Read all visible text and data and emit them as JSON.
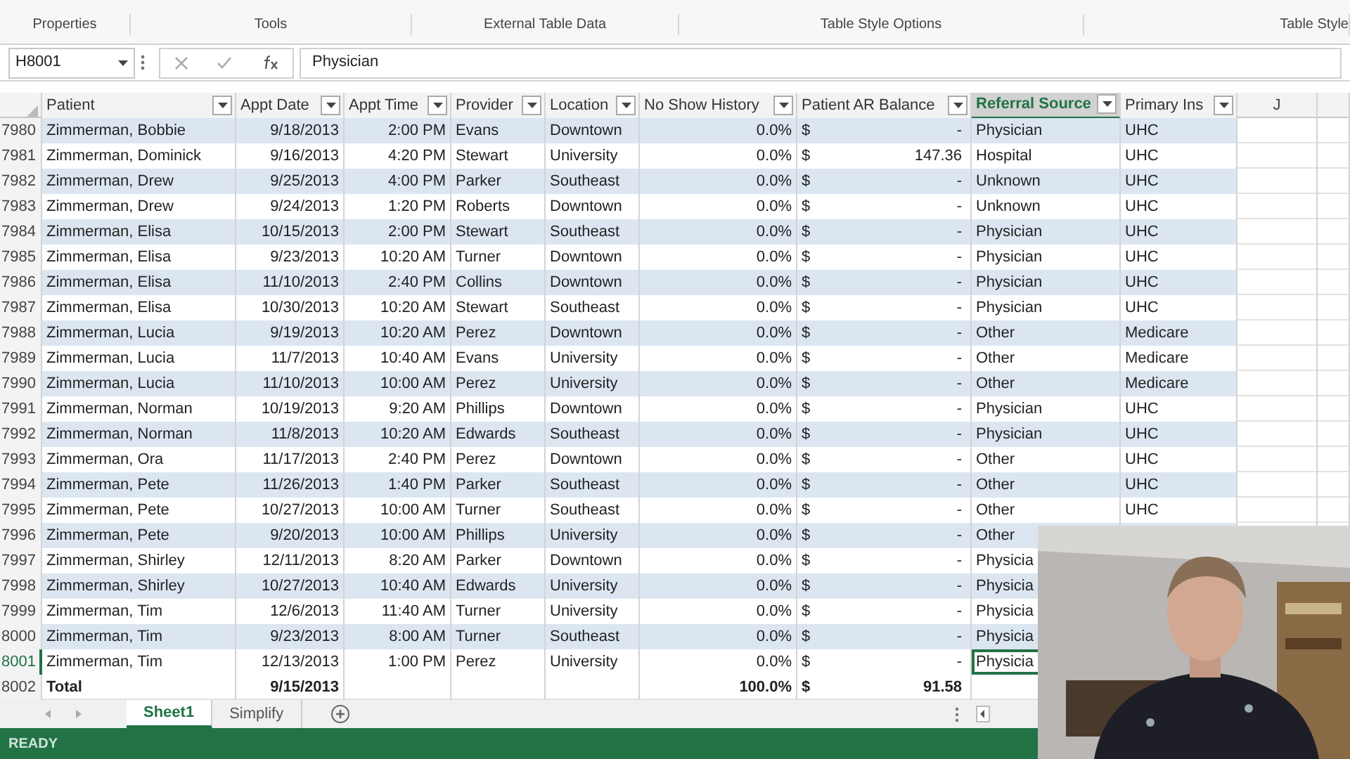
{
  "ribbon": {
    "groups": [
      "Properties",
      "Tools",
      "External Table Data",
      "Table Style Options",
      "Table Style"
    ]
  },
  "formula_bar": {
    "name_box": "H8001",
    "value": "Physician"
  },
  "columns": [
    {
      "kind": "filter",
      "label": "Patient",
      "selected": false
    },
    {
      "kind": "filter",
      "label": "Appt Date",
      "selected": false
    },
    {
      "kind": "filter",
      "label": "Appt Time",
      "selected": false
    },
    {
      "kind": "filter",
      "label": "Provider",
      "selected": false
    },
    {
      "kind": "filter",
      "label": "Location",
      "selected": false
    },
    {
      "kind": "filter",
      "label": "No Show History",
      "selected": false
    },
    {
      "kind": "filter",
      "label": "Patient AR Balance",
      "selected": false
    },
    {
      "kind": "filter",
      "label": "Referral Source",
      "selected": true
    },
    {
      "kind": "filter",
      "label": "Primary Ins",
      "selected": false
    },
    {
      "kind": "letter",
      "label": "J"
    }
  ],
  "rows": [
    {
      "n": "7980",
      "patient": "Zimmerman, Bobbie",
      "date": "9/18/2013",
      "time": "2:00 PM",
      "provider": "Evans",
      "location": "Downtown",
      "noshow": "0.0%",
      "cur": "$",
      "bal": "-",
      "ref": "Physician",
      "ins": "UHC",
      "selected": false
    },
    {
      "n": "7981",
      "patient": "Zimmerman, Dominick",
      "date": "9/16/2013",
      "time": "4:20 PM",
      "provider": "Stewart",
      "location": "University",
      "noshow": "0.0%",
      "cur": "$",
      "bal": "147.36",
      "ref": "Hospital",
      "ins": "UHC",
      "selected": false
    },
    {
      "n": "7982",
      "patient": "Zimmerman, Drew",
      "date": "9/25/2013",
      "time": "4:00 PM",
      "provider": "Parker",
      "location": "Southeast",
      "noshow": "0.0%",
      "cur": "$",
      "bal": "-",
      "ref": "Unknown",
      "ins": "UHC",
      "selected": false
    },
    {
      "n": "7983",
      "patient": "Zimmerman, Drew",
      "date": "9/24/2013",
      "time": "1:20 PM",
      "provider": "Roberts",
      "location": "Downtown",
      "noshow": "0.0%",
      "cur": "$",
      "bal": "-",
      "ref": "Unknown",
      "ins": "UHC",
      "selected": false
    },
    {
      "n": "7984",
      "patient": "Zimmerman, Elisa",
      "date": "10/15/2013",
      "time": "2:00 PM",
      "provider": "Stewart",
      "location": "Southeast",
      "noshow": "0.0%",
      "cur": "$",
      "bal": "-",
      "ref": "Physician",
      "ins": "UHC",
      "selected": false
    },
    {
      "n": "7985",
      "patient": "Zimmerman, Elisa",
      "date": "9/23/2013",
      "time": "10:20 AM",
      "provider": "Turner",
      "location": "Downtown",
      "noshow": "0.0%",
      "cur": "$",
      "bal": "-",
      "ref": "Physician",
      "ins": "UHC",
      "selected": false
    },
    {
      "n": "7986",
      "patient": "Zimmerman, Elisa",
      "date": "11/10/2013",
      "time": "2:40 PM",
      "provider": "Collins",
      "location": "Downtown",
      "noshow": "0.0%",
      "cur": "$",
      "bal": "-",
      "ref": "Physician",
      "ins": "UHC",
      "selected": false
    },
    {
      "n": "7987",
      "patient": "Zimmerman, Elisa",
      "date": "10/30/2013",
      "time": "10:20 AM",
      "provider": "Stewart",
      "location": "Southeast",
      "noshow": "0.0%",
      "cur": "$",
      "bal": "-",
      "ref": "Physician",
      "ins": "UHC",
      "selected": false
    },
    {
      "n": "7988",
      "patient": "Zimmerman, Lucia",
      "date": "9/19/2013",
      "time": "10:20 AM",
      "provider": "Perez",
      "location": "Downtown",
      "noshow": "0.0%",
      "cur": "$",
      "bal": "-",
      "ref": "Other",
      "ins": "Medicare",
      "selected": false
    },
    {
      "n": "7989",
      "patient": "Zimmerman, Lucia",
      "date": "11/7/2013",
      "time": "10:40 AM",
      "provider": "Evans",
      "location": "University",
      "noshow": "0.0%",
      "cur": "$",
      "bal": "-",
      "ref": "Other",
      "ins": "Medicare",
      "selected": false
    },
    {
      "n": "7990",
      "patient": "Zimmerman, Lucia",
      "date": "11/10/2013",
      "time": "10:00 AM",
      "provider": "Perez",
      "location": "University",
      "noshow": "0.0%",
      "cur": "$",
      "bal": "-",
      "ref": "Other",
      "ins": "Medicare",
      "selected": false
    },
    {
      "n": "7991",
      "patient": "Zimmerman, Norman",
      "date": "10/19/2013",
      "time": "9:20 AM",
      "provider": "Phillips",
      "location": "Downtown",
      "noshow": "0.0%",
      "cur": "$",
      "bal": "-",
      "ref": "Physician",
      "ins": "UHC",
      "selected": false
    },
    {
      "n": "7992",
      "patient": "Zimmerman, Norman",
      "date": "11/8/2013",
      "time": "10:20 AM",
      "provider": "Edwards",
      "location": "Southeast",
      "noshow": "0.0%",
      "cur": "$",
      "bal": "-",
      "ref": "Physician",
      "ins": "UHC",
      "selected": false
    },
    {
      "n": "7993",
      "patient": "Zimmerman, Ora",
      "date": "11/17/2013",
      "time": "2:40 PM",
      "provider": "Perez",
      "location": "Downtown",
      "noshow": "0.0%",
      "cur": "$",
      "bal": "-",
      "ref": "Other",
      "ins": "UHC",
      "selected": false
    },
    {
      "n": "7994",
      "patient": "Zimmerman, Pete",
      "date": "11/26/2013",
      "time": "1:40 PM",
      "provider": "Parker",
      "location": "Southeast",
      "noshow": "0.0%",
      "cur": "$",
      "bal": "-",
      "ref": "Other",
      "ins": "UHC",
      "selected": false
    },
    {
      "n": "7995",
      "patient": "Zimmerman, Pete",
      "date": "10/27/2013",
      "time": "10:00 AM",
      "provider": "Turner",
      "location": "Southeast",
      "noshow": "0.0%",
      "cur": "$",
      "bal": "-",
      "ref": "Other",
      "ins": "UHC",
      "selected": false
    },
    {
      "n": "7996",
      "patient": "Zimmerman, Pete",
      "date": "9/20/2013",
      "time": "10:00 AM",
      "provider": "Phillips",
      "location": "University",
      "noshow": "0.0%",
      "cur": "$",
      "bal": "-",
      "ref": "Other",
      "selected": false
    },
    {
      "n": "7997",
      "patient": "Zimmerman, Shirley",
      "date": "12/11/2013",
      "time": "8:20 AM",
      "provider": "Parker",
      "location": "Downtown",
      "noshow": "0.0%",
      "cur": "$",
      "bal": "-",
      "ref": "Physicia",
      "selected": false
    },
    {
      "n": "7998",
      "patient": "Zimmerman, Shirley",
      "date": "10/27/2013",
      "time": "10:40 AM",
      "provider": "Edwards",
      "location": "University",
      "noshow": "0.0%",
      "cur": "$",
      "bal": "-",
      "ref": "Physicia",
      "selected": false
    },
    {
      "n": "7999",
      "patient": "Zimmerman, Tim",
      "date": "12/6/2013",
      "time": "11:40 AM",
      "provider": "Turner",
      "location": "University",
      "noshow": "0.0%",
      "cur": "$",
      "bal": "-",
      "ref": "Physicia",
      "selected": false
    },
    {
      "n": "8000",
      "patient": "Zimmerman, Tim",
      "date": "9/23/2013",
      "time": "8:00 AM",
      "provider": "Turner",
      "location": "Southeast",
      "noshow": "0.0%",
      "cur": "$",
      "bal": "-",
      "ref": "Physicia",
      "selected": false
    },
    {
      "n": "8001",
      "patient": "Zimmerman, Tim",
      "date": "12/13/2013",
      "time": "1:00 PM",
      "provider": "Perez",
      "location": "University",
      "noshow": "0.0%",
      "cur": "$",
      "bal": "-",
      "ref": "Physicia",
      "selected": true
    }
  ],
  "total_row": {
    "n": "8002",
    "patient": "Total",
    "date": "9/15/2013",
    "noshow": "100.0%",
    "cur": "$",
    "bal": "91.58"
  },
  "sheet_tabs": [
    {
      "label": "Sheet1",
      "selected": true
    },
    {
      "label": "Simplify",
      "selected": false
    }
  ],
  "status_bar": {
    "text": "READY"
  }
}
